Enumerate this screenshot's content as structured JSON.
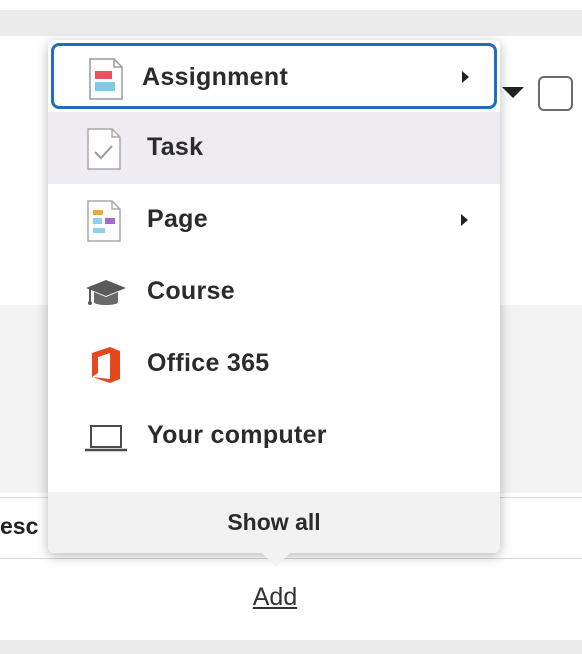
{
  "menu": {
    "items": [
      {
        "label": "Assignment",
        "icon": "assignment-icon",
        "has_submenu": true
      },
      {
        "label": "Task",
        "icon": "task-icon",
        "has_submenu": false
      },
      {
        "label": "Page",
        "icon": "page-icon",
        "has_submenu": true
      },
      {
        "label": "Course",
        "icon": "graduation-cap-icon",
        "has_submenu": false
      },
      {
        "label": "Office 365",
        "icon": "office-365-icon",
        "has_submenu": false
      },
      {
        "label": "Your computer",
        "icon": "laptop-icon",
        "has_submenu": false
      }
    ],
    "show_all_label": "Show all"
  },
  "background": {
    "row_text": "esc",
    "add_link": "Add"
  },
  "colors": {
    "focus_border": "#1f6fbf",
    "hover_background": "#eeebf1",
    "office_orange": "#e8461e",
    "assignment_red": "#ef4f5f",
    "assignment_blue": "#7fcbe6"
  }
}
